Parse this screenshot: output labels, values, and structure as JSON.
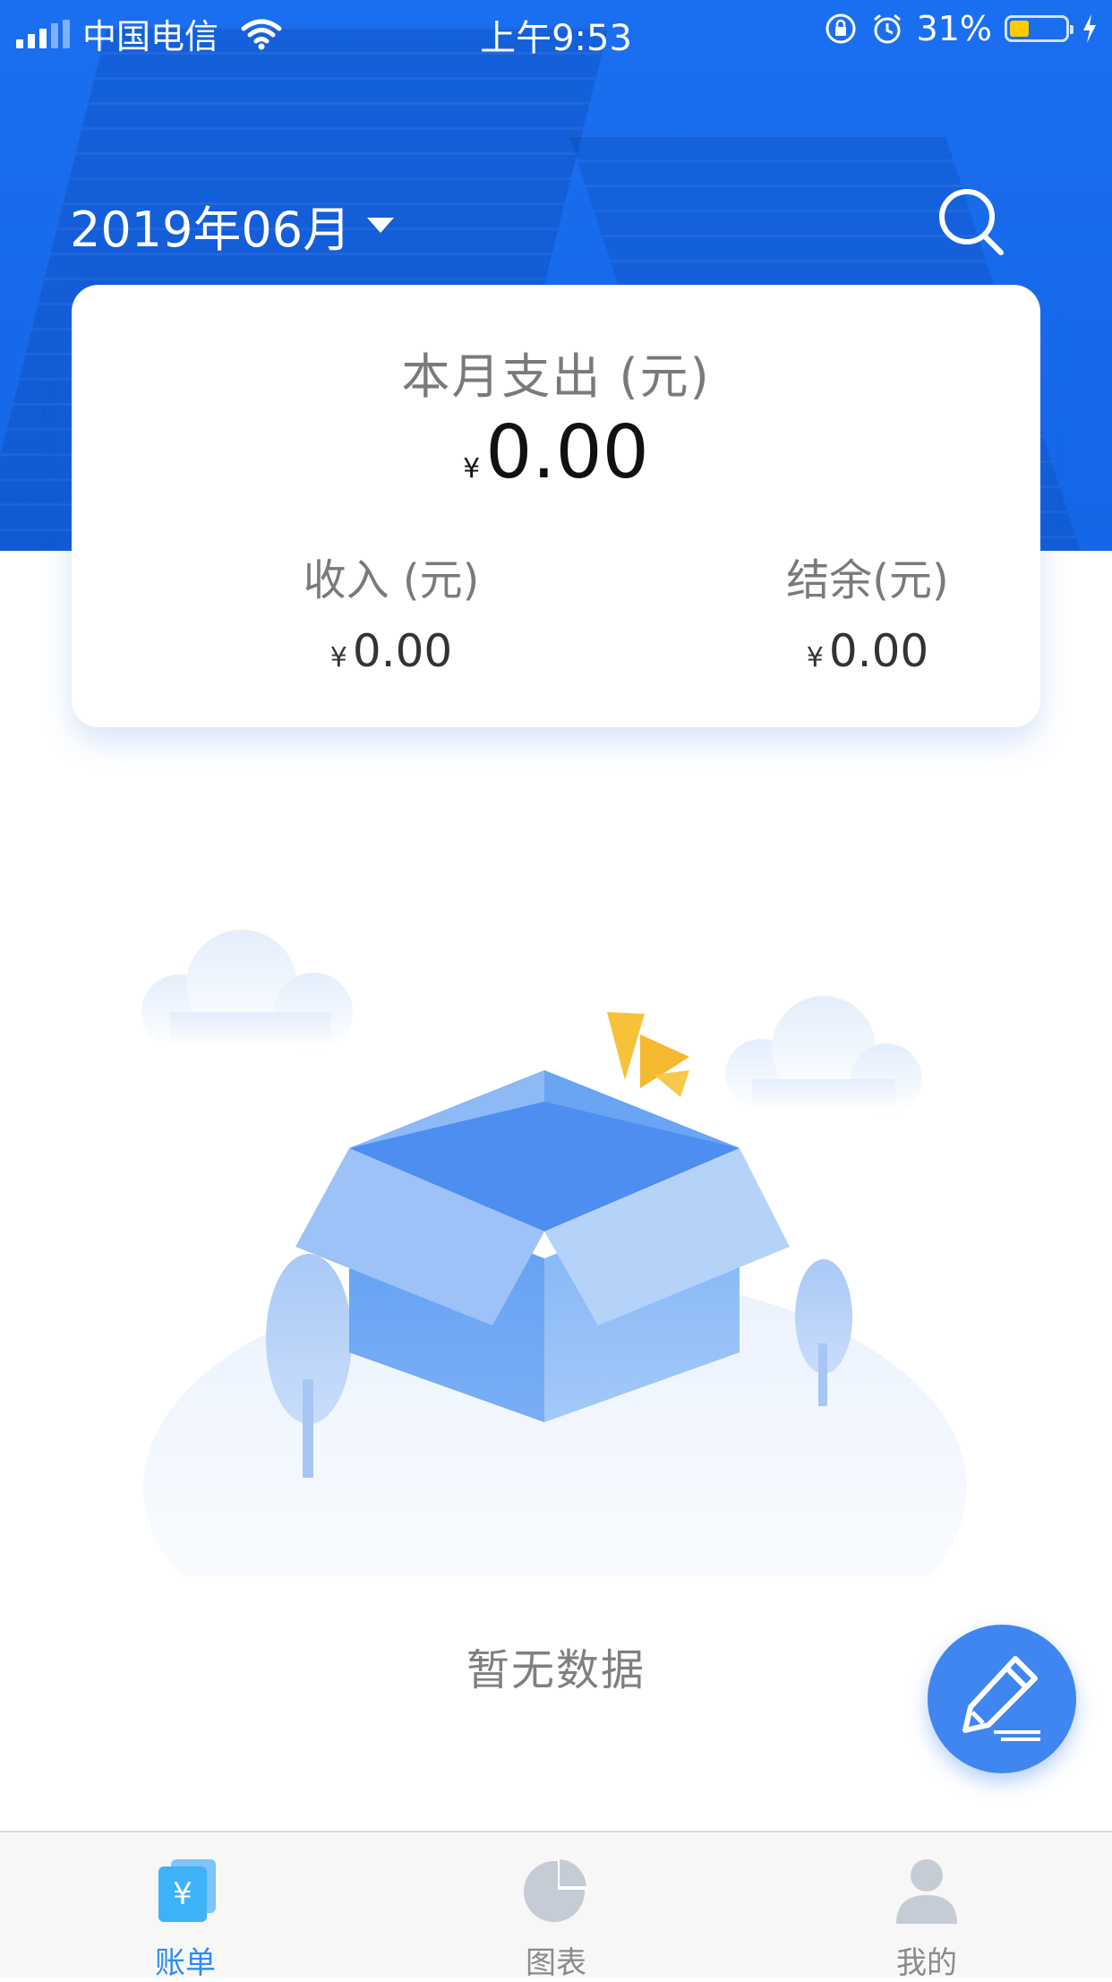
{
  "status_bar": {
    "carrier": "中国电信",
    "time": "上午9:53",
    "battery": "31%",
    "battery_level": 0.31
  },
  "header": {
    "month": "2019年06月"
  },
  "summary": {
    "expense_label": "本月支出 (元)",
    "currency": "¥",
    "expense_value": "0.00",
    "income_label": "收入 (元)",
    "income_value": "0.00",
    "balance_label": "结余(元)",
    "balance_value": "0.00"
  },
  "empty_state": {
    "text": "暂无数据"
  },
  "tabs": [
    {
      "label": "账单",
      "icon": "bill-icon",
      "active": true
    },
    {
      "label": "图表",
      "icon": "pie-chart-icon",
      "active": false
    },
    {
      "label": "我的",
      "icon": "user-icon",
      "active": false
    }
  ],
  "colors": {
    "header_blue": "#1a6ff0",
    "accent_blue": "#2d8cf0",
    "fab_blue": "#3f86f0",
    "battery_yellow": "#ffcc00"
  }
}
